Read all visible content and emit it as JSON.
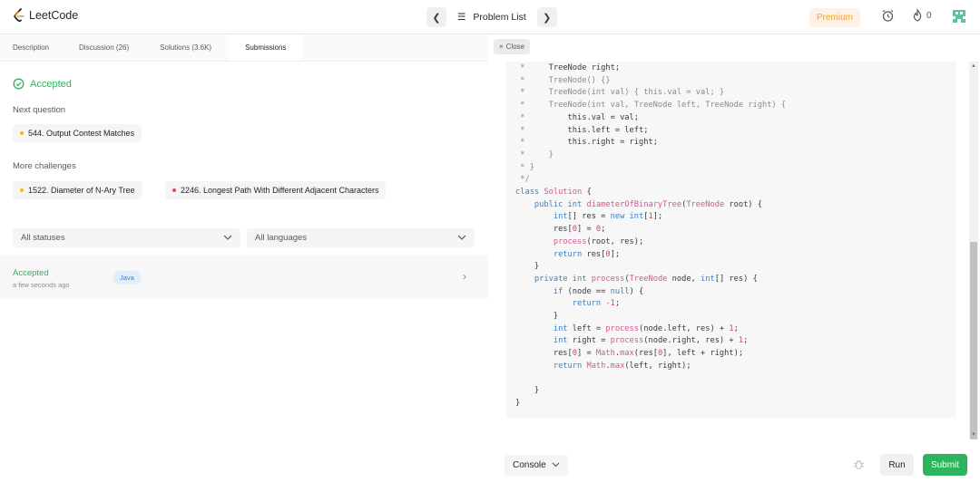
{
  "header": {
    "logo_text": "LeetCode",
    "problem_list": "Problem List",
    "premium": "Premium",
    "streak_count": "0"
  },
  "tabs": [
    {
      "label": "Description"
    },
    {
      "label": "Discussion (26)"
    },
    {
      "label": "Solutions (3.6K)"
    },
    {
      "label": "Submissions"
    }
  ],
  "result": {
    "status": "Accepted",
    "next_question_label": "Next question",
    "next_question": "544. Output Contest Matches",
    "more_challenges_label": "More challenges",
    "challenges": [
      {
        "title": "1522. Diameter of N-Ary Tree"
      },
      {
        "title": "2246. Longest Path With Different Adjacent Characters"
      }
    ]
  },
  "filters": {
    "status": "All statuses",
    "language": "All languages"
  },
  "submission": {
    "status": "Accepted",
    "time": "a few seconds ago",
    "language": "Java"
  },
  "editor": {
    "close_label": "Close",
    "console_label": "Console",
    "run_label": "Run",
    "submit_label": "Submit"
  },
  "colors": {
    "accent_green": "#2db55d",
    "premium_orange": "#ffa116",
    "medium_orange": "#ffb800",
    "hard_red": "#ef4743"
  }
}
